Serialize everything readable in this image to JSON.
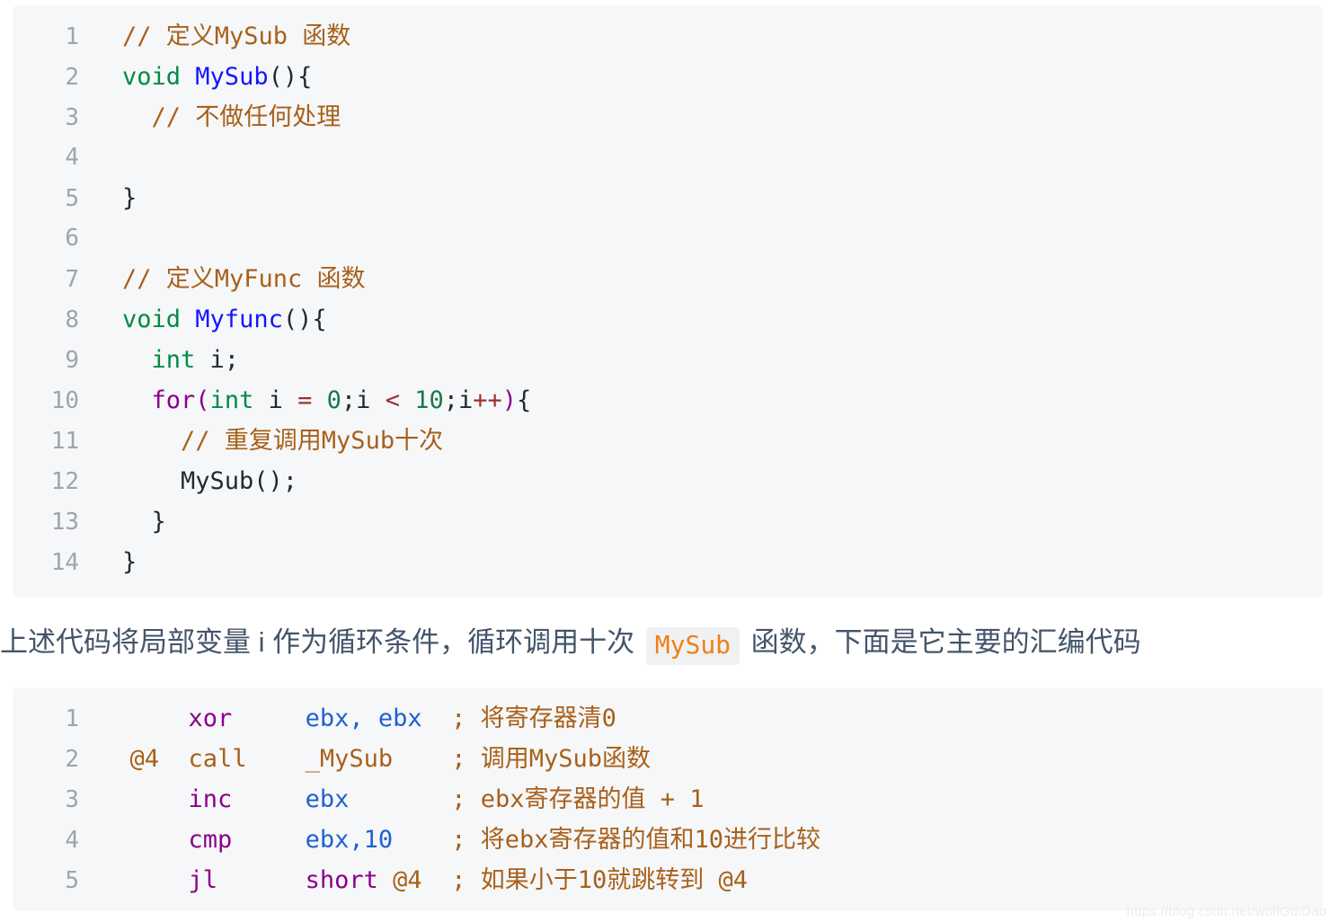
{
  "code_block_c": {
    "language": "c",
    "background_color": "#f6f7f8",
    "lines": [
      {
        "n": "1",
        "tokens": [
          {
            "t": "// 定义MySub 函数",
            "c": "comment"
          }
        ]
      },
      {
        "n": "2",
        "tokens": [
          {
            "t": "void",
            "c": "type"
          },
          {
            "t": " ",
            "c": "plain"
          },
          {
            "t": "MySub",
            "c": "fn"
          },
          {
            "t": "(){",
            "c": "punc"
          }
        ]
      },
      {
        "n": "3",
        "tokens": [
          {
            "t": "  ",
            "c": "plain"
          },
          {
            "t": "// 不做任何处理",
            "c": "comment"
          }
        ]
      },
      {
        "n": "4",
        "tokens": [
          {
            "t": "",
            "c": "plain"
          }
        ]
      },
      {
        "n": "5",
        "tokens": [
          {
            "t": "}",
            "c": "punc"
          }
        ]
      },
      {
        "n": "6",
        "tokens": [
          {
            "t": "",
            "c": "plain"
          }
        ]
      },
      {
        "n": "7",
        "tokens": [
          {
            "t": "// 定义MyFunc 函数",
            "c": "comment"
          }
        ]
      },
      {
        "n": "8",
        "tokens": [
          {
            "t": "void",
            "c": "type"
          },
          {
            "t": " ",
            "c": "plain"
          },
          {
            "t": "Myfunc",
            "c": "fn"
          },
          {
            "t": "(){",
            "c": "punc"
          }
        ]
      },
      {
        "n": "9",
        "tokens": [
          {
            "t": "  ",
            "c": "plain"
          },
          {
            "t": "int",
            "c": "type"
          },
          {
            "t": " i;",
            "c": "plain"
          }
        ]
      },
      {
        "n": "10",
        "tokens": [
          {
            "t": "  ",
            "c": "plain"
          },
          {
            "t": "for",
            "c": "kw"
          },
          {
            "t": "(",
            "c": "kw"
          },
          {
            "t": "int",
            "c": "type"
          },
          {
            "t": " i ",
            "c": "plain"
          },
          {
            "t": "=",
            "c": "op"
          },
          {
            "t": " ",
            "c": "plain"
          },
          {
            "t": "0",
            "c": "num"
          },
          {
            "t": ";i ",
            "c": "plain"
          },
          {
            "t": "<",
            "c": "op"
          },
          {
            "t": " ",
            "c": "plain"
          },
          {
            "t": "10",
            "c": "num"
          },
          {
            "t": ";i",
            "c": "plain"
          },
          {
            "t": "++",
            "c": "op"
          },
          {
            "t": ")",
            "c": "kw"
          },
          {
            "t": "{",
            "c": "punc"
          }
        ]
      },
      {
        "n": "11",
        "tokens": [
          {
            "t": "    ",
            "c": "plain"
          },
          {
            "t": "// 重复调用MySub十次",
            "c": "comment"
          }
        ]
      },
      {
        "n": "12",
        "tokens": [
          {
            "t": "    MySub();",
            "c": "plain"
          }
        ]
      },
      {
        "n": "13",
        "tokens": [
          {
            "t": "  }",
            "c": "punc"
          }
        ]
      },
      {
        "n": "14",
        "tokens": [
          {
            "t": "}",
            "c": "punc"
          }
        ]
      }
    ]
  },
  "paragraph": {
    "before": "上述代码将局部变量 i 作为循环条件，循环调用十次",
    "inline_code": "MySub",
    "after": "函数，下面是它主要的汇编代码"
  },
  "code_block_asm": {
    "language": "asm",
    "background_color": "#f6f7f8",
    "lines": [
      {
        "n": "1",
        "tokens": [
          {
            "t": "      ",
            "c": "plain"
          },
          {
            "t": "xor",
            "c": "kw"
          },
          {
            "t": "     ",
            "c": "plain"
          },
          {
            "t": "ebx, ebx",
            "c": "reg"
          },
          {
            "t": "  ",
            "c": "plain"
          },
          {
            "t": "; 将寄存器清0",
            "c": "comment"
          }
        ]
      },
      {
        "n": "2",
        "tokens": [
          {
            "t": "  ",
            "c": "plain"
          },
          {
            "t": "@4",
            "c": "label"
          },
          {
            "t": "  ",
            "c": "plain"
          },
          {
            "t": "call",
            "c": "label"
          },
          {
            "t": "    ",
            "c": "plain"
          },
          {
            "t": "_MySub",
            "c": "label"
          },
          {
            "t": "    ",
            "c": "plain"
          },
          {
            "t": "; 调用MySub函数",
            "c": "comment"
          }
        ]
      },
      {
        "n": "3",
        "tokens": [
          {
            "t": "      ",
            "c": "plain"
          },
          {
            "t": "inc",
            "c": "kw"
          },
          {
            "t": "     ",
            "c": "plain"
          },
          {
            "t": "ebx",
            "c": "reg"
          },
          {
            "t": "       ",
            "c": "plain"
          },
          {
            "t": "; ebx寄存器的值 + 1",
            "c": "comment"
          }
        ]
      },
      {
        "n": "4",
        "tokens": [
          {
            "t": "      ",
            "c": "plain"
          },
          {
            "t": "cmp",
            "c": "kw"
          },
          {
            "t": "     ",
            "c": "plain"
          },
          {
            "t": "ebx,10",
            "c": "reg"
          },
          {
            "t": "    ",
            "c": "plain"
          },
          {
            "t": "; 将ebx寄存器的值和10进行比较",
            "c": "comment"
          }
        ]
      },
      {
        "n": "5",
        "tokens": [
          {
            "t": "      ",
            "c": "plain"
          },
          {
            "t": "jl",
            "c": "kw"
          },
          {
            "t": "      ",
            "c": "plain"
          },
          {
            "t": "short",
            "c": "kw"
          },
          {
            "t": " ",
            "c": "plain"
          },
          {
            "t": "@4",
            "c": "label"
          },
          {
            "t": "  ",
            "c": "plain"
          },
          {
            "t": "; 如果小于10就跳转到 @4",
            "c": "comment"
          }
        ]
      }
    ]
  },
  "watermark": "https://blog.csdn.net/wolfGuiDao",
  "colors": {
    "comment": "#a8601a",
    "type": "#008b45",
    "function": "#1414ff",
    "keyword": "#8b008b",
    "number": "#1a7a4a",
    "operator": "#9c3030",
    "register": "#2060d0",
    "plain": "#24292e",
    "line_number": "#a0a4a8",
    "code_bg": "#f6f7f8",
    "paragraph_text": "#44546a",
    "inline_code_text": "#f08018",
    "inline_code_bg": "#f0f1f2",
    "page_bg": "#ffffff"
  }
}
